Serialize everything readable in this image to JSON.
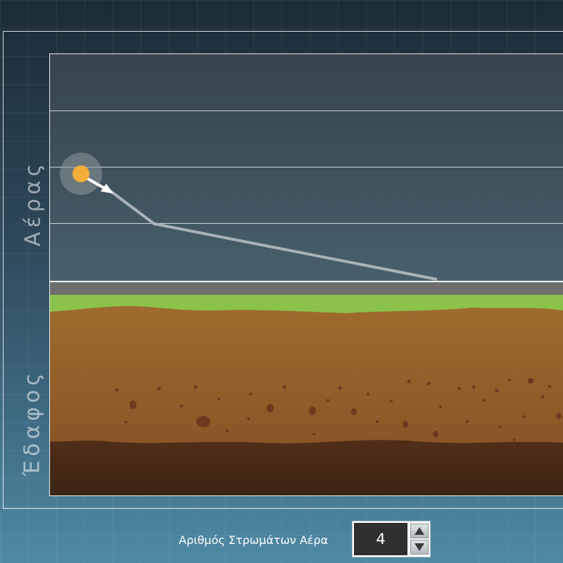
{
  "labels": {
    "air": "Αέρας",
    "soil": "Έδαφος"
  },
  "control": {
    "label": "Αριθμός Στρωμάτων Αέρα",
    "layers_value": "4"
  },
  "colors": {
    "grass": "#8bc34a",
    "topsoil": "#9c6a2e",
    "subsoil": "#6a3b20",
    "sun": "#f5ad3a",
    "ray": "#a9b3b8"
  },
  "icons": {
    "spin_up": "triangle-up-icon",
    "spin_down": "triangle-down-icon",
    "ray_arrow": "arrow-head-icon"
  }
}
